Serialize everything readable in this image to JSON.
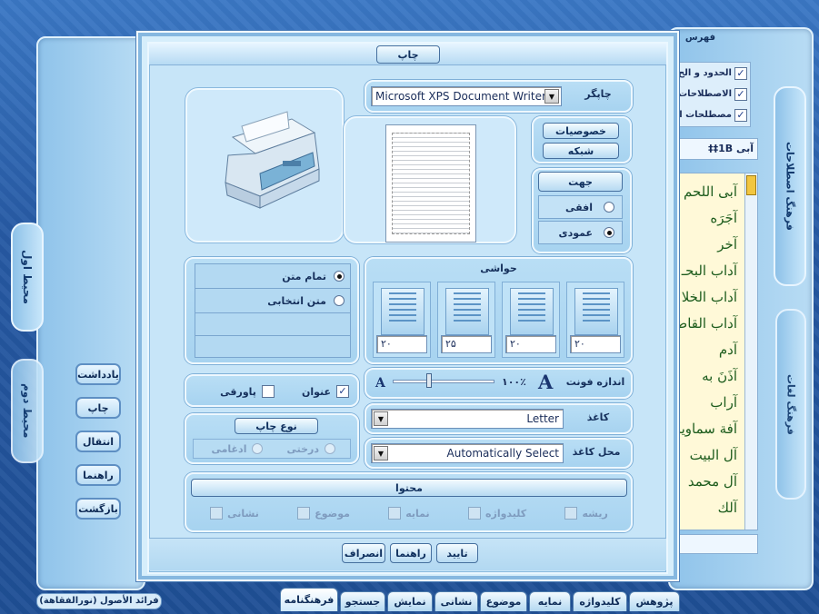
{
  "dialog": {
    "title": "چاپ",
    "printer_label": "چاپگر",
    "printer_value": "Microsoft XPS Document Writer",
    "properties_button": "خصوصیات",
    "network_button": "شبکه",
    "orientation": {
      "title": "جهت",
      "landscape": "افقی",
      "portrait": "عمودی",
      "selected": "portrait"
    },
    "margins": {
      "title": "حواشی",
      "values": [
        "۲۰",
        "۲۰",
        "۲۵",
        "۲۰"
      ]
    },
    "scope": {
      "full_text": "تمام متن",
      "selected_text": "متن انتخابی",
      "selected": "full_text"
    },
    "font_size": {
      "label": "اندازه فونت",
      "value": "۱۰۰٪",
      "letter": "A",
      "level": 0.35
    },
    "header": {
      "title_label": "عنوان",
      "title_checked": true,
      "footnote_label": "پاورقی",
      "footnote_checked": false
    },
    "print_type": {
      "title": "نوع چاپ",
      "tree": "درختی",
      "merged": "ادغامی"
    },
    "paper": {
      "label": "کاغذ",
      "value": "Letter"
    },
    "paper_source": {
      "label": "محل کاغذ",
      "value": "Automatically Select"
    },
    "content": {
      "title": "محتوا",
      "items": [
        "ریشه",
        "کلیدواژه",
        "نمایه",
        "موضوع",
        "نشانی"
      ]
    },
    "buttons": {
      "ok": "تایید",
      "help": "راهنما",
      "cancel": "انصراف"
    }
  },
  "left_panel": {
    "tabs": [
      "محیط اول",
      "محیط دوم"
    ],
    "buttons": [
      "یادداشت",
      "چاپ",
      "انتقال",
      "راهنما",
      "بازگشت"
    ]
  },
  "right_panel": {
    "header": "فهرس",
    "checks": [
      "الحدود و الح",
      "الاصطلاحات",
      "مصطلحات ا"
    ],
    "search_value": "آبی 1‌B‡‡",
    "terms": [
      "آبی اللحم",
      "آجَرَه",
      "آخر",
      "آداب البحـ",
      "آداب الخلا",
      "آداب القاضـ",
      "آدم",
      "آذَنَ به",
      "آراب",
      "آفة سماوية",
      "آل البیت",
      "آل محمد",
      "آلك"
    ],
    "vtabs": [
      "فرهنگ اصطلاحات",
      "فرهنگ لغات"
    ]
  },
  "bottom_tabs": [
    "پژوهش",
    "کلیدواژه",
    "نمایه",
    "موضوع",
    "نشانی",
    "نمایش",
    "جستجو",
    "فرهنگنامه"
  ],
  "status": "فرائد الأصول (نورالفقاهة)"
}
